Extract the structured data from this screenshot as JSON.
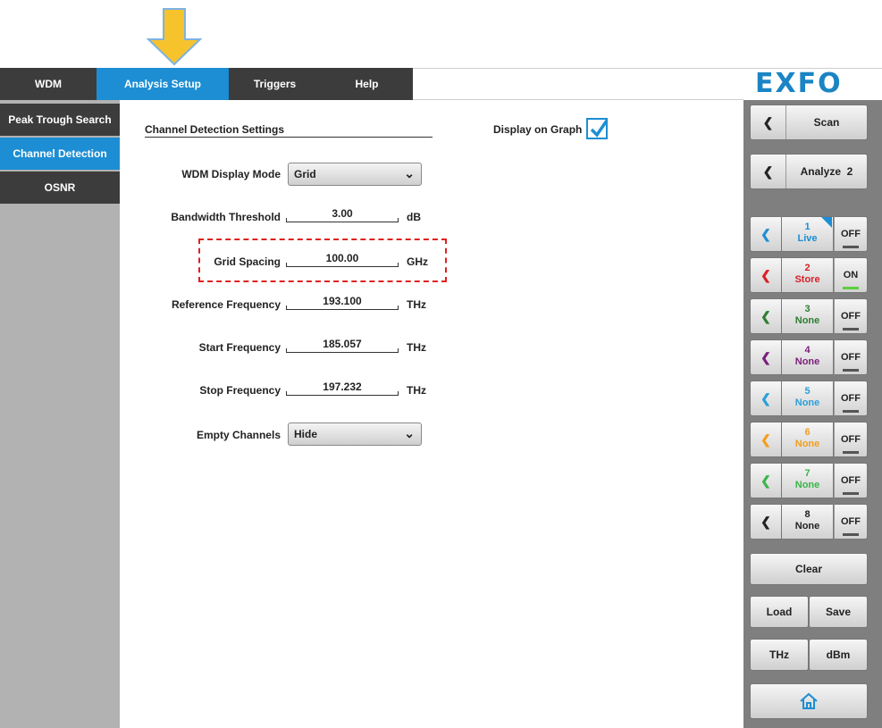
{
  "topbar": {
    "tabs": [
      "WDM",
      "Analysis Setup",
      "Triggers",
      "Help"
    ],
    "active_tab": "Analysis Setup",
    "logo": "EXFO"
  },
  "sidebar": {
    "items": [
      "Peak Trough Search",
      "Channel Detection",
      "OSNR"
    ],
    "active": "Channel Detection"
  },
  "main": {
    "section_title": "Channel Detection Settings",
    "display_on_graph_label": "Display on Graph",
    "display_on_graph_checked": true,
    "wdm_display_mode": {
      "label": "WDM Display Mode",
      "value": "Grid"
    },
    "bandwidth_threshold": {
      "label": "Bandwidth Threshold",
      "value": "3.00",
      "unit": "dB"
    },
    "grid_spacing": {
      "label": "Grid Spacing",
      "value": "100.00",
      "unit": "GHz"
    },
    "reference_frequency": {
      "label": "Reference Frequency",
      "value": "193.100",
      "unit": "THz"
    },
    "start_frequency": {
      "label": "Start Frequency",
      "value": "185.057",
      "unit": "THz"
    },
    "stop_frequency": {
      "label": "Stop Frequency",
      "value": "197.232",
      "unit": "THz"
    },
    "empty_channels": {
      "label": "Empty Channels",
      "value": "Hide"
    }
  },
  "right_panel": {
    "scan_label": "Scan",
    "analyze_label": "Analyze  2",
    "traces": [
      {
        "num": "1",
        "name": "Live",
        "state": "OFF",
        "color": "#1d8ed3"
      },
      {
        "num": "2",
        "name": "Store",
        "state": "ON",
        "color": "#d9202a"
      },
      {
        "num": "3",
        "name": "None",
        "state": "OFF",
        "color": "#2e7d32"
      },
      {
        "num": "4",
        "name": "None",
        "state": "OFF",
        "color": "#7b1e7a"
      },
      {
        "num": "5",
        "name": "None",
        "state": "OFF",
        "color": "#2b9fd9"
      },
      {
        "num": "6",
        "name": "None",
        "state": "OFF",
        "color": "#f29d1c"
      },
      {
        "num": "7",
        "name": "None",
        "state": "OFF",
        "color": "#39b54a"
      },
      {
        "num": "8",
        "name": "None",
        "state": "OFF",
        "color": "#222222"
      }
    ],
    "clear_label": "Clear",
    "load_label": "Load",
    "save_label": "Save",
    "thz_label": "THz",
    "dbm_label": "dBm",
    "home_icon": "home-icon"
  },
  "colors": {
    "accent": "#1d8ed3",
    "dark": "#3c3c3c",
    "annotation_arrow": "#f6c32d",
    "highlight": "#e02020"
  }
}
